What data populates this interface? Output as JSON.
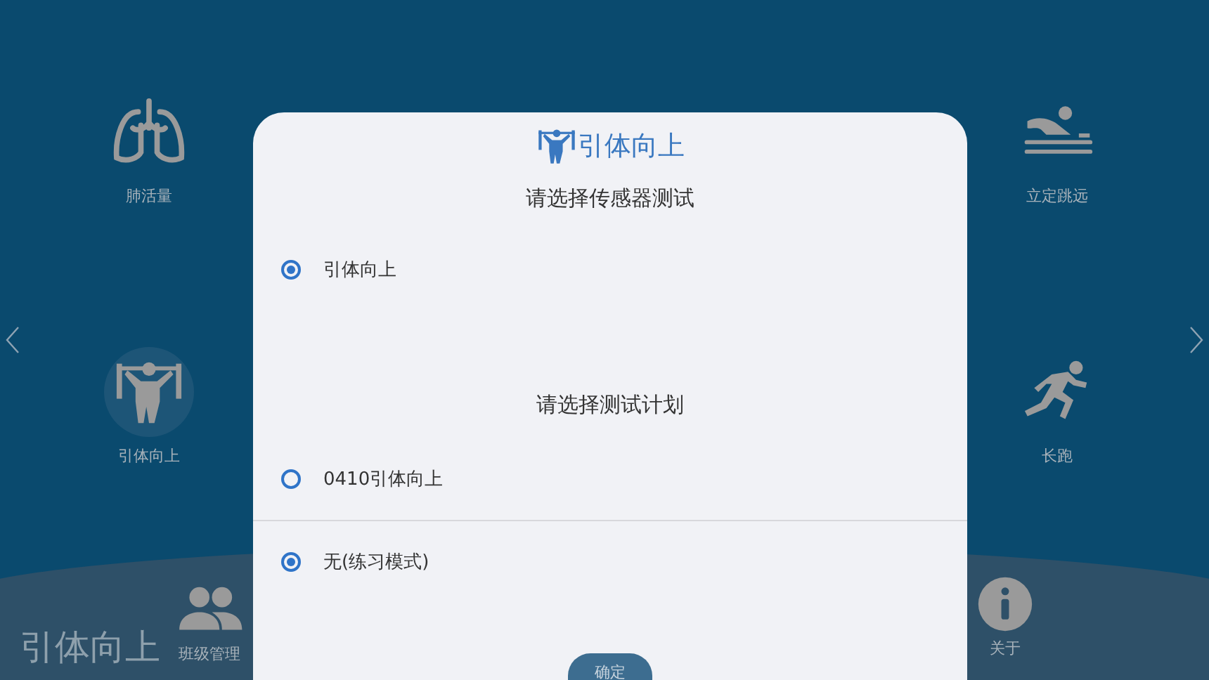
{
  "home": {
    "tiles": [
      {
        "kind": "lungs",
        "label": "肺活量",
        "selected": false
      },
      {
        "kind": "jump",
        "label": "立定跳远",
        "selected": false
      },
      {
        "kind": "pullup",
        "label": "引体向上",
        "selected": true
      },
      {
        "kind": "run",
        "label": "长跑",
        "selected": false
      }
    ],
    "bottom_bar": {
      "current_test": "引体向上",
      "items": [
        {
          "kind": "group",
          "label": "班级管理"
        },
        {
          "kind": "info",
          "label": "关于"
        }
      ]
    }
  },
  "dialog": {
    "title": "引体向上",
    "sensor_heading": "请选择传感器测试",
    "sensors": [
      {
        "label": "引体向上",
        "selected": true
      }
    ],
    "plan_heading": "请选择测试计划",
    "plans": [
      {
        "label": "0410引体向上",
        "selected": false
      },
      {
        "label": "无(练习模式)",
        "selected": true
      }
    ],
    "confirm_button": "确定"
  }
}
